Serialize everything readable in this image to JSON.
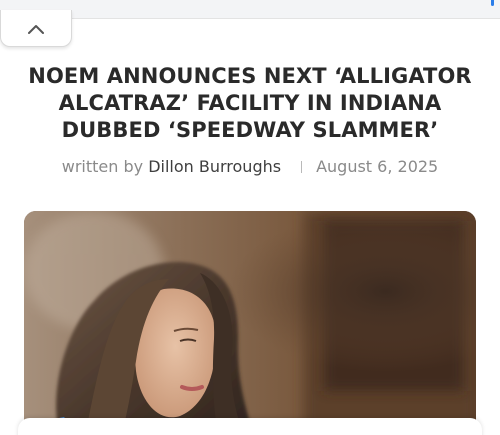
{
  "article": {
    "headline": "NOEM ANNOUNCES NEXT ‘ALLIGATOR ALCATRAZ’ FACILITY IN INDIANA DUBBED ‘SPEEDWAY SLAMMER’",
    "byline": {
      "prefix": "written by",
      "author": "Dillon Burroughs",
      "date": "August 6, 2025"
    }
  },
  "ui": {
    "collapse_icon": "chevron-up-icon",
    "accent_color": "#2b7de9"
  }
}
